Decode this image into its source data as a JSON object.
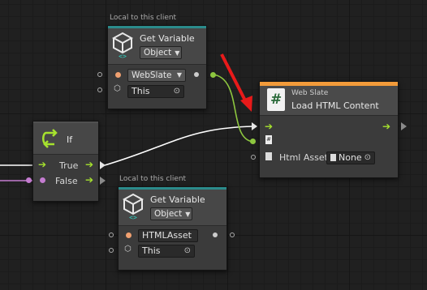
{
  "colors": {
    "flow": "#a6e22e",
    "object_port": "#f0a070",
    "boolean_port": "#c47cd0",
    "teal_header": "#2b8b8b",
    "orange_header": "#f29b3a",
    "annotation_arrow": "#e81a1a"
  },
  "get_variable_top": {
    "caption": "Local to this client",
    "title": "Get Variable",
    "kind": "Object",
    "name_value": "WebSlate",
    "target_value": "This",
    "icon": "cube-variable-icon"
  },
  "get_variable_bottom": {
    "caption": "Local to this client",
    "title": "Get Variable",
    "kind": "Object",
    "name_value": "HTMLAsset",
    "target_value": "This",
    "icon": "cube-variable-icon"
  },
  "if_node": {
    "title": "If",
    "true_label": "True",
    "false_label": "False",
    "icon": "branch-arrows-icon"
  },
  "load_node": {
    "subtitle": "Web Slate",
    "title": "Load HTML Content",
    "hash_label": "#",
    "asset_label": "Html Asset",
    "asset_value": "None",
    "icon": "hash-icon"
  }
}
